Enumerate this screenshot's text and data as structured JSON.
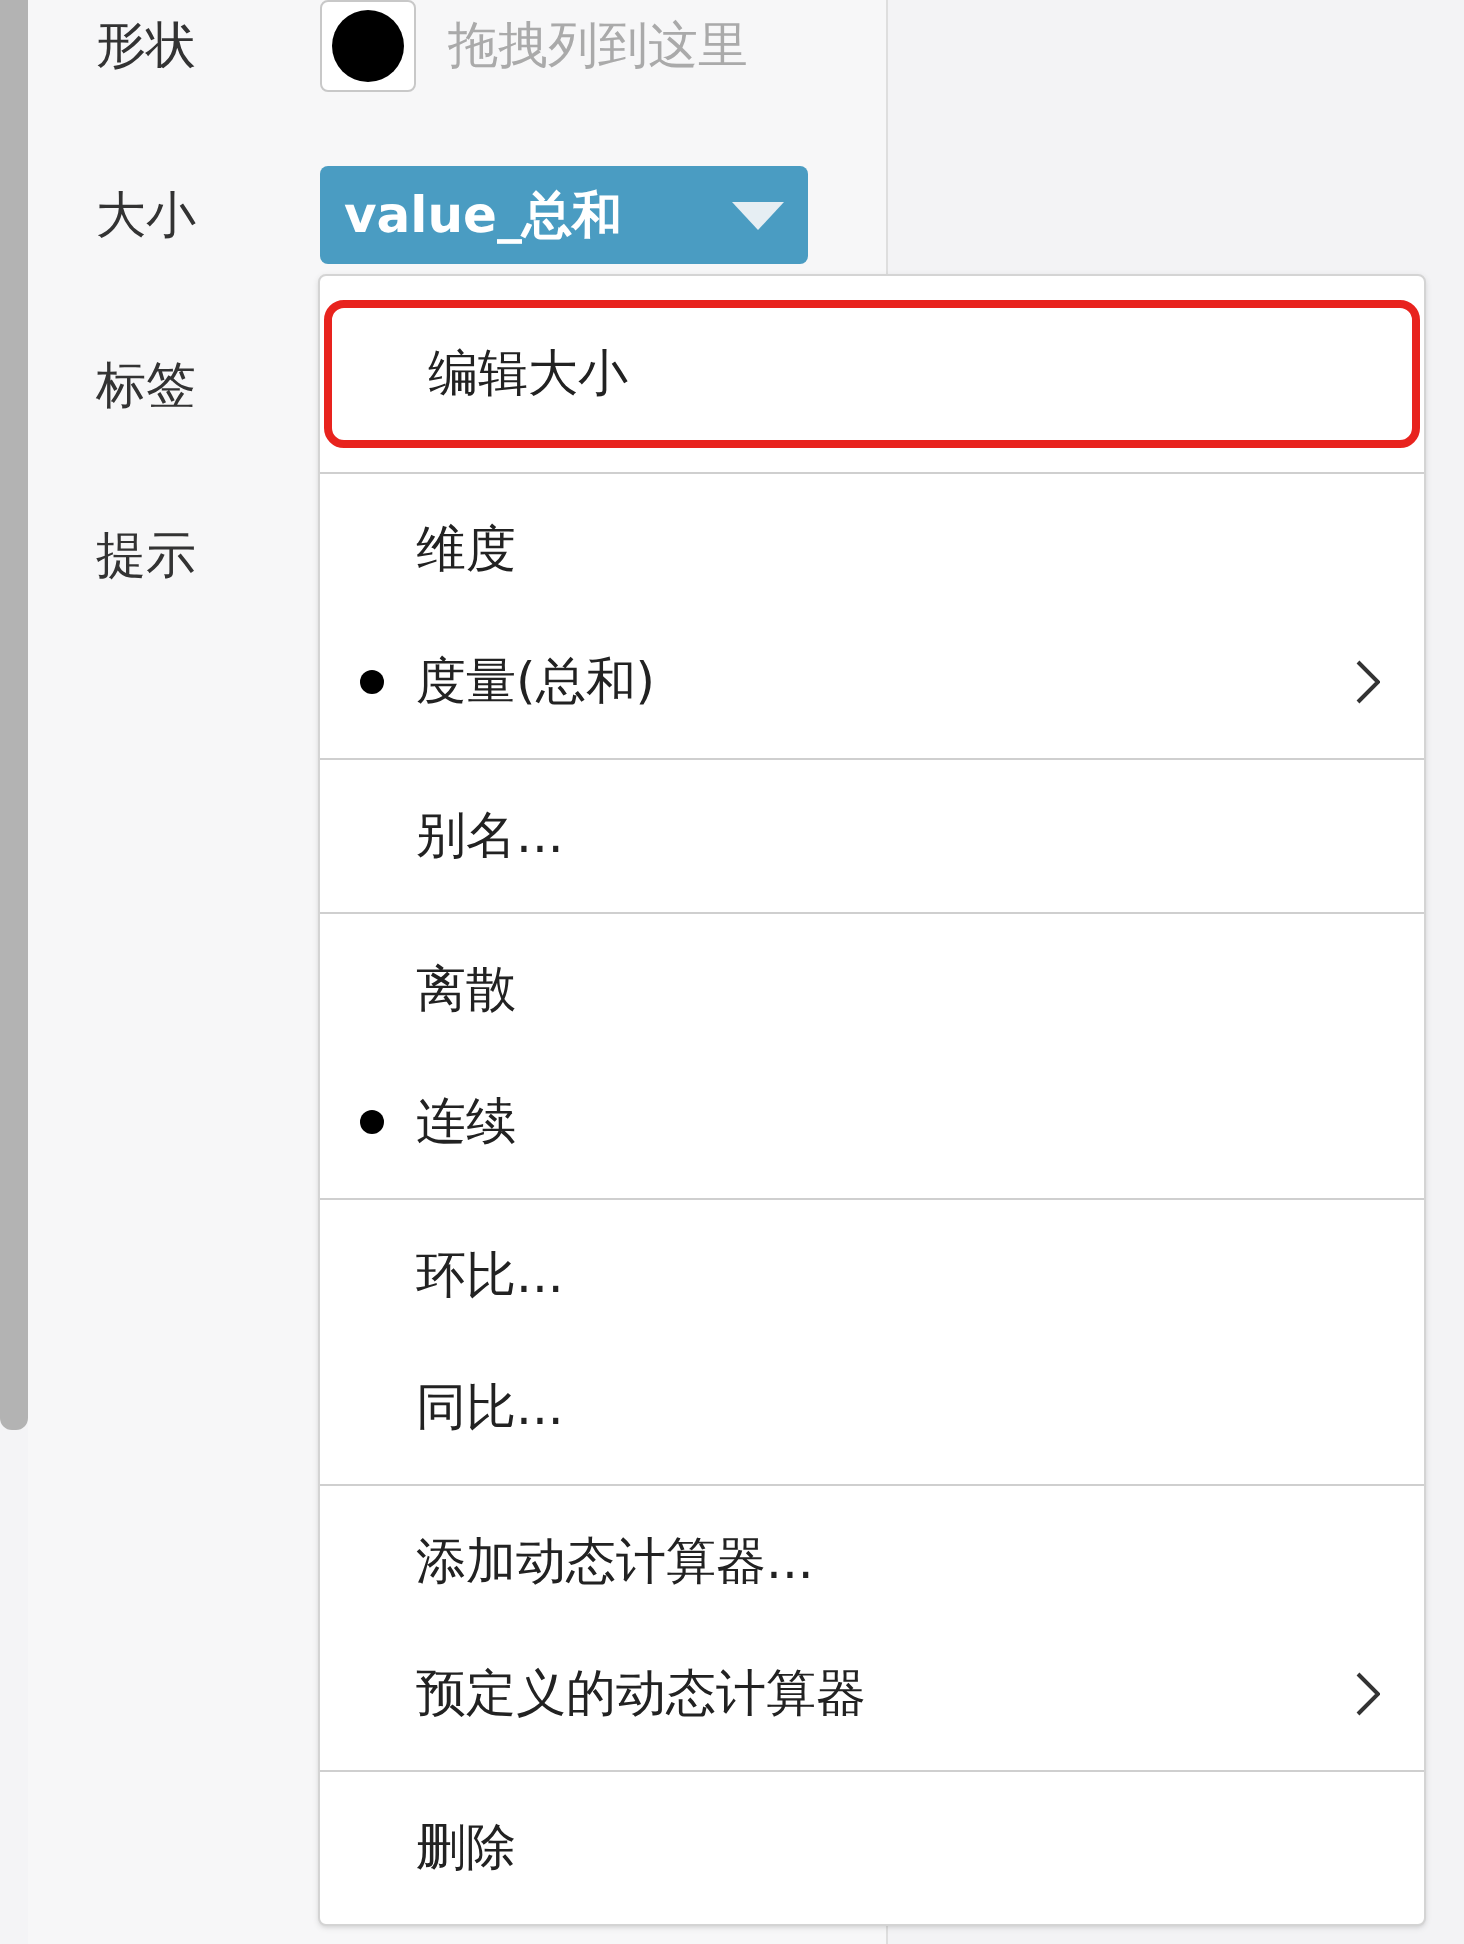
{
  "fields": [
    {
      "label": "形状",
      "kind": "shape",
      "placeholder": "拖拽列到这里"
    },
    {
      "label": "大小",
      "kind": "pill",
      "value": "value_总和"
    },
    {
      "label": "标签",
      "kind": "empty"
    },
    {
      "label": "提示",
      "kind": "empty"
    }
  ],
  "menu": {
    "sections": [
      {
        "items": [
          {
            "label": "编辑大小",
            "selected": false,
            "has_submenu": false,
            "highlighted": true
          }
        ]
      },
      {
        "items": [
          {
            "label": "维度",
            "selected": false,
            "has_submenu": false,
            "highlighted": false
          },
          {
            "label": "度量(总和)",
            "selected": true,
            "has_submenu": true,
            "highlighted": false
          }
        ]
      },
      {
        "items": [
          {
            "label": "别名...",
            "selected": false,
            "has_submenu": false,
            "highlighted": false
          }
        ]
      },
      {
        "items": [
          {
            "label": "离散",
            "selected": false,
            "has_submenu": false,
            "highlighted": false
          },
          {
            "label": "连续",
            "selected": true,
            "has_submenu": false,
            "highlighted": false
          }
        ]
      },
      {
        "items": [
          {
            "label": "环比...",
            "selected": false,
            "has_submenu": false,
            "highlighted": false
          },
          {
            "label": "同比...",
            "selected": false,
            "has_submenu": false,
            "highlighted": false
          }
        ]
      },
      {
        "items": [
          {
            "label": "添加动态计算器...",
            "selected": false,
            "has_submenu": false,
            "highlighted": false
          },
          {
            "label": "预定义的动态计算器",
            "selected": false,
            "has_submenu": true,
            "highlighted": false
          }
        ]
      },
      {
        "items": [
          {
            "label": "删除",
            "selected": false,
            "has_submenu": false,
            "highlighted": false
          }
        ]
      }
    ]
  }
}
